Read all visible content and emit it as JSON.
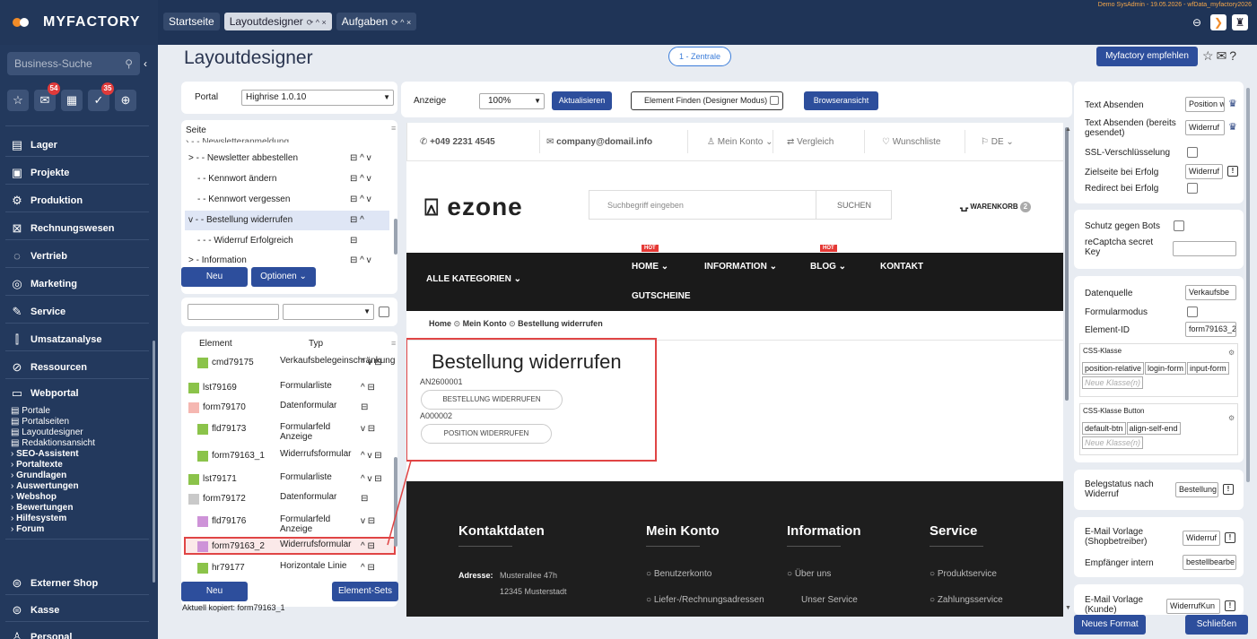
{
  "app": {
    "logo": "MYFACTORY",
    "tabs": [
      {
        "label": "Startseite",
        "active": false
      },
      {
        "label": "Layoutdesigner",
        "active": true,
        "controls": "⟳ ^ ×"
      },
      {
        "label": "Aufgaben",
        "active": false,
        "controls": "⟳ ^ ×"
      }
    ],
    "userline": "Demo SysAdmin - 19.05.2026 - wfData_myfactory2026"
  },
  "sidebar": {
    "search_placeholder": "Business-Suche",
    "badges": {
      "mail": "54",
      "tasks": "35"
    },
    "nav": [
      {
        "label": "Lager",
        "icon": "warehouse-icon"
      },
      {
        "label": "Projekte",
        "icon": "project-icon"
      },
      {
        "label": "Produktion",
        "icon": "production-icon"
      },
      {
        "label": "Rechnungswesen",
        "icon": "accounting-icon"
      },
      {
        "label": "Vertrieb",
        "icon": "sales-icon"
      },
      {
        "label": "Marketing",
        "icon": "marketing-icon"
      },
      {
        "label": "Service",
        "icon": "service-icon"
      },
      {
        "label": "Umsatzanalyse",
        "icon": "chart-icon"
      },
      {
        "label": "Ressourcen",
        "icon": "resources-icon"
      },
      {
        "label": "Webportal",
        "icon": "webportal-icon"
      }
    ],
    "webportal_items": [
      "Portale",
      "Portalseiten",
      "Layoutdesigner",
      "Redaktionsansicht"
    ],
    "webportal_groups": [
      "SEO-Assistent",
      "Portaltexte",
      "Grundlagen",
      "Auswertungen",
      "Webshop",
      "Bewertungen",
      "Hilfesystem",
      "Forum"
    ],
    "nav_bottom": [
      {
        "label": "Externer Shop",
        "icon": "external-shop-icon"
      },
      {
        "label": "Kasse",
        "icon": "cash-register-icon"
      },
      {
        "label": "Personal",
        "icon": "personnel-icon"
      }
    ]
  },
  "header": {
    "title": "Layoutdesigner",
    "zentrale": "1 - Zentrale",
    "empfehlen": "Myfactory empfehlen"
  },
  "left": {
    "portal_label": "Portal",
    "portal_value": "Highrise 1.0.10",
    "seite_label": "Seite",
    "page_rows": [
      {
        "label": "> - - Newsletter abbestellen",
        "actions": "⊟ ^ v",
        "selected": false
      },
      {
        "label": "- - Kennwort ändern",
        "actions": "⊟ ^ v",
        "selected": false
      },
      {
        "label": "- - Kennwort vergessen",
        "actions": "⊟ ^ v",
        "selected": false
      },
      {
        "label": "v - - Bestellung widerrufen",
        "actions": "⊟ ^",
        "selected": true
      },
      {
        "label": "- - - Widerruf Erfolgreich",
        "actions": "⊟",
        "selected": false
      },
      {
        "label": "> - Information",
        "actions": "⊟ ^ v",
        "selected": false
      }
    ],
    "btn_neu": "Neu",
    "btn_optionen": "Optionen ⌄",
    "col_element": "Element",
    "col_typ": "Typ",
    "elements": [
      {
        "name": "cmd79175",
        "type": "Verkaufsbelegeinschränkung",
        "actions": "^ v ⊟",
        "color": "#8bc34a",
        "indent": 18
      },
      {
        "name": "lst79169",
        "type": "Formularliste",
        "actions": "^ ⊟",
        "color": "#8bc34a",
        "indent": 8,
        "exp": "v"
      },
      {
        "name": "form79170",
        "type": "Datenformular",
        "actions": "⊟",
        "color": "#f5b7b1",
        "indent": 8,
        "exp": "v"
      },
      {
        "name": "fld79173",
        "type": "Formularfeld Anzeige",
        "actions": "v ⊟",
        "color": "#8bc34a",
        "indent": 18
      },
      {
        "name": "form79163_1",
        "type": "Widerrufsformular",
        "actions": "^ v ⊟",
        "color": "#8bc34a",
        "indent": 18
      },
      {
        "name": "lst79171",
        "type": "Formularliste",
        "actions": "^ v ⊟",
        "color": "#8bc34a",
        "indent": 8,
        "exp": "v"
      },
      {
        "name": "form79172",
        "type": "Datenformular",
        "actions": "⊟",
        "color": "#c9c9c9",
        "indent": 8,
        "exp": "v"
      },
      {
        "name": "fld79176",
        "type": "Formularfeld Anzeige",
        "actions": "v ⊟",
        "color": "#ce93d8",
        "indent": 18
      },
      {
        "name": "form79163_2",
        "type": "Widerrufsformular",
        "actions": "^ ⊟",
        "color": "#ce93d8",
        "indent": 18,
        "selected": true
      },
      {
        "name": "hr79177",
        "type": "Horizontale Linie",
        "actions": "^ ⊟",
        "color": "#8bc34a",
        "indent": 18
      }
    ],
    "btn_neu2": "Neu",
    "btn_sets": "Element-Sets",
    "copied": "Aktuell kopiert: form79163_1"
  },
  "toolbar": {
    "anzeige_label": "Anzeige",
    "zoom": "100%",
    "btn_refresh": "Aktualisieren",
    "btn_find": "Element Finden (Designer Modus)",
    "btn_browser": "Browseransicht"
  },
  "preview": {
    "phone": "+049 2231 4545",
    "email": "company@domail.info",
    "account": "Mein Konto ⌄",
    "compare": "Vergleich",
    "wishlist": "Wunschliste",
    "lang": "DE ⌄",
    "brand": "ezone",
    "search_placeholder": "Suchbegriff eingeben",
    "search_btn": "SUCHEN",
    "cart": "WARENKORB",
    "cart_count": "2",
    "nav_all": "ALLE KATEGORIEN ⌄",
    "nav": [
      "HOME ⌄",
      "INFORMATION ⌄",
      "BLOG ⌄",
      "KONTAKT"
    ],
    "nav_second": "GUTSCHEINE",
    "hot": "HOT",
    "breadcrumb": [
      "Home",
      "Mein Konto",
      "Bestellung widerrufen"
    ],
    "heading": "Bestellung widerrufen",
    "order_no": "AN2600001",
    "btn_order": "BESTELLUNG WIDERRUFEN",
    "pos_no": "A000002",
    "btn_pos": "POSITION WIDERRUFEN",
    "footer_cols": [
      "Kontaktdaten",
      "Mein Konto",
      "Information",
      "Service"
    ],
    "address_label": "Adresse:",
    "address1": "Musterallee 47h",
    "address2": "12345 Musterstadt",
    "konto_links": [
      "Benutzerkonto",
      "Liefer-/Rechnungsadressen"
    ],
    "info_links": [
      "Über uns",
      "Unser Service"
    ],
    "service_links": [
      "Produktservice",
      "Zahlungsservice"
    ]
  },
  "right": {
    "text_absenden": "Text Absenden",
    "text_absenden_val": "Position w",
    "text_absenden_sent": "Text Absenden (bereits gesendet)",
    "text_absenden_sent_val": "Widerruf",
    "ssl": "SSL-Verschlüsselung",
    "zielseite": "Zielseite bei Erfolg",
    "zielseite_val": "Widerruf",
    "redirect": "Redirect bei Erfolg",
    "bots": "Schutz gegen Bots",
    "recaptcha": "reCaptcha secret Key",
    "datenquelle": "Datenquelle",
    "datenquelle_val": "Verkaufsbe",
    "formularmodus": "Formularmodus",
    "element_id": "Element-ID",
    "element_id_val": "form79163_2",
    "css_klasse": "CSS-Klasse",
    "css_tags": [
      "position-relative",
      "login-form",
      "input-form"
    ],
    "css_placeholder": "Neue Klasse(n)",
    "css_btn": "CSS-Klasse Button",
    "css_btn_tags": [
      "default-btn",
      "align-self-end"
    ],
    "belegstatus": "Belegstatus nach Widerruf",
    "belegstatus_val": "Bestellung",
    "email_shop": "E-Mail Vorlage (Shopbetreiber)",
    "email_shop_val": "Widerruf",
    "empfaenger": "Empfänger intern",
    "empfaenger_val": "bestellbearbe",
    "email_kunde": "E-Mail Vorlage (Kunde)",
    "email_kunde_val": "WiderrufKun",
    "btn_format": "Neues Format",
    "btn_close": "Schließen"
  }
}
